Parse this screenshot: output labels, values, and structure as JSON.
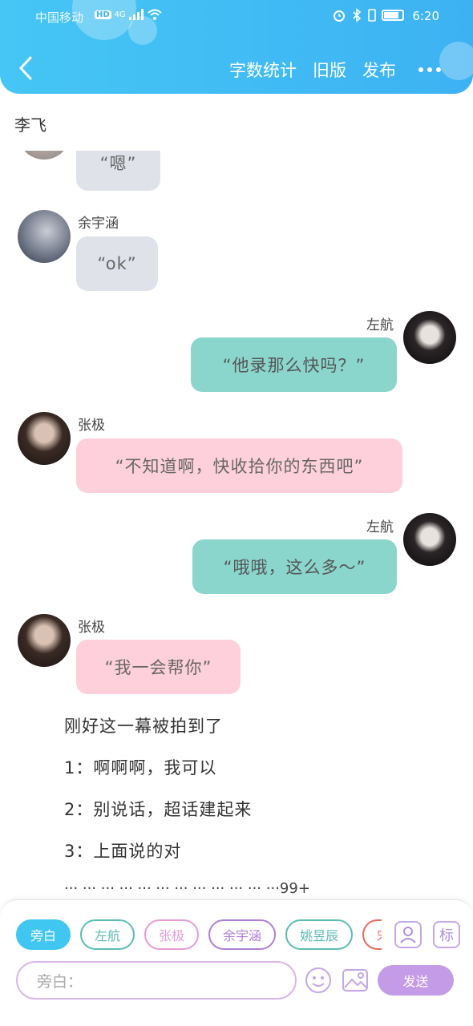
{
  "status_bar": {
    "carrier": "中国移动",
    "hd": "HD",
    "network": "4G",
    "time": "6:20"
  },
  "header": {
    "actions": [
      "字数统计",
      "旧版",
      "发布"
    ]
  },
  "title": "李飞",
  "messages": [
    {
      "side": "left",
      "name": "",
      "text": "“嗯”",
      "style": "gray"
    },
    {
      "side": "left",
      "name": "余宇涵",
      "text": "“ok”",
      "style": "gray"
    },
    {
      "side": "right",
      "name": "左航",
      "text": "“他录那么快吗？”",
      "style": "teal"
    },
    {
      "side": "left",
      "name": "张极",
      "text": "“不知道啊，快收拾你的东西吧”",
      "style": "pink"
    },
    {
      "side": "right",
      "name": "左航",
      "text": "“哦哦，这么多～”",
      "style": "teal"
    },
    {
      "side": "left",
      "name": "张极",
      "text": "“我一会帮你”",
      "style": "pink"
    }
  ],
  "narration": [
    "刚好这一幕被拍到了",
    "1：啊啊啊，我可以",
    "2：别说话，超话建起来",
    "3：上面说的对"
  ],
  "dots_line": "··· ··· ··· ··· ··· ··· ··· ··· ··· ··· ··· ···99+",
  "chips": [
    {
      "label": "旁白",
      "color": "#3fc6f1",
      "filled": true
    },
    {
      "label": "左航",
      "color": "#5cbcb4",
      "filled": false
    },
    {
      "label": "张极",
      "color": "#e99bd9",
      "filled": false
    },
    {
      "label": "余宇涵",
      "color": "#b07fd8",
      "filled": false
    },
    {
      "label": "姚昱辰",
      "color": "#5cbcb4",
      "filled": false
    },
    {
      "label": "宋",
      "color": "#e76a5a",
      "filled": false
    }
  ],
  "tools": {
    "mark_label": "标"
  },
  "input": {
    "placeholder": "旁白："
  },
  "send_label": "发送"
}
